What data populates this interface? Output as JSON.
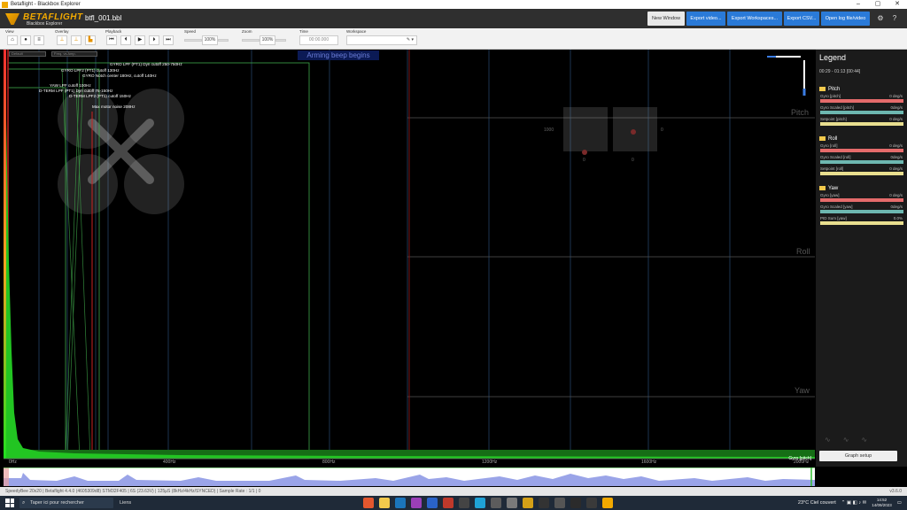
{
  "window": {
    "title": "Betaflight - Blackbox Explorer",
    "controls": [
      "–",
      "▢",
      "✕"
    ]
  },
  "header": {
    "logo_brand": "BETAFLIGHT",
    "logo_sub": "Blackbox Explorer",
    "filename": "btfl_001.bbl",
    "buttons": {
      "new_window": "New Window",
      "export_video": "Export video...",
      "export_workspaces": "Export Workspaces...",
      "export_csv": "Export CSV...",
      "open_log": "Open log file/video"
    }
  },
  "toolbar": {
    "view_label": "View",
    "overlay_label": "Overlay",
    "playback_label": "Playback",
    "speed_label": "Speed",
    "speed_value": "100%",
    "zoom_label": "Zoom",
    "zoom_value": "100%",
    "time_label": "Time",
    "time_value": "00:00.000",
    "workspace_label": "Workspace",
    "workspace_value": "✎ ▾"
  },
  "graph": {
    "arming_banner": "Arming beep begins",
    "filters": [
      "GYRO LPF (PT1) Dyn cutoff 250-750Hz",
      "GYRO LPF2 (PT1) cutoff 130Hz",
      "GYRO Notch center 180Hz, cutoff 140Hz",
      "YAW LPF cutoff 100Hz",
      "D-TERM LPF (PT1) Dyn cutoff 75-150Hz",
      "D-TERM LPF2 (PT1) cutoff 150Hz",
      "Max motor noise 208Hz"
    ],
    "pid_labels": {
      "pitch": "Pitch",
      "roll": "Roll",
      "yaw": "Yaw"
    },
    "stick_values": {
      "left_top": "1000",
      "right_top": "0",
      "left_bottom": "0",
      "right_bottom": "0"
    },
    "x_ticks": [
      "0Hz",
      "400Hz",
      "800Hz",
      "1200Hz",
      "1600Hz",
      "2000Hz"
    ],
    "corner_label": "Gyro [pitch]",
    "colors": {
      "spectrum": "#22c522",
      "grid": "#1f3b55",
      "marker": "#cc2222",
      "filter_box": "#3fa84a"
    }
  },
  "legend": {
    "title": "Legend",
    "range": "00:29 - 01:13 [00:44]",
    "groups": [
      {
        "name": "Pitch",
        "items": [
          {
            "label": "Gyro [pitch]",
            "value": "0 deg/s",
            "color": "#e56b6b"
          },
          {
            "label": "Gyro Scaled [pitch]",
            "value": "0deg/s",
            "color": "#6db7b0"
          },
          {
            "label": "Setpoint [pitch]",
            "value": "0 deg/s",
            "color": "#e9df8f"
          }
        ]
      },
      {
        "name": "Roll",
        "items": [
          {
            "label": "Gyro [roll]",
            "value": "0 deg/s",
            "color": "#e56b6b"
          },
          {
            "label": "Gyro Scaled [roll]",
            "value": "0deg/s",
            "color": "#6db7b0"
          },
          {
            "label": "Setpoint [roll]",
            "value": "0 deg/s",
            "color": "#e9df8f"
          }
        ]
      },
      {
        "name": "Yaw",
        "items": [
          {
            "label": "Gyro [yaw]",
            "value": "0 deg/s",
            "color": "#e56b6b"
          },
          {
            "label": "Gyro Scaled [yaw]",
            "value": "0deg/s",
            "color": "#6db7b0"
          },
          {
            "label": "PID Sum [yaw]",
            "value": "0.0%",
            "color": "#e9df8f"
          }
        ]
      }
    ],
    "setup_button": "Graph setup"
  },
  "statusbar": {
    "text": "SpeedyBee 20x20 | Betaflight 4.4.0 (4605309d8) STM32F405 | 6S (23.63V) | 125µS (8kHz/4kHz/SYNCED) | Sample Rate : 1/1 | 0",
    "version": "v3.6.0"
  },
  "taskbar": {
    "search_placeholder": "Taper ici pour rechercher",
    "news": "Liens",
    "weather": "23°C  Ciel couvert",
    "time": "14:52",
    "date": "14/09/2023"
  }
}
